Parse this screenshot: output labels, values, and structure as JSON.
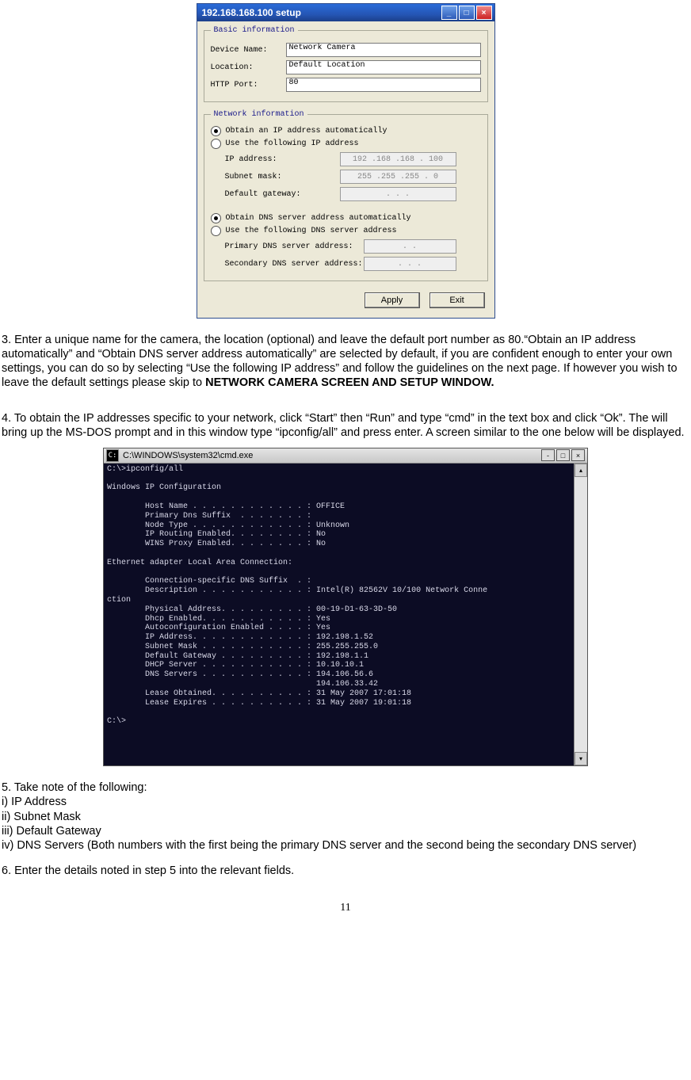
{
  "setup": {
    "title": "192.168.168.100 setup",
    "basic_legend": "Basic information",
    "device_name_label": "Device Name:",
    "device_name_value": "Network Camera",
    "location_label": "Location:",
    "location_value": "Default Location",
    "http_port_label": "HTTP Port:",
    "http_port_value": "80",
    "net_legend": "Network information",
    "radio_auto_ip": "Obtain an IP address automatically",
    "radio_static_ip": "Use the following IP address",
    "ip_label": "IP address:",
    "ip_value": "192 .168 .168 . 100",
    "mask_label": "Subnet mask:",
    "mask_value": "255 .255 .255 .  0",
    "gateway_label": "Default gateway:",
    "gateway_value": ".    .    .",
    "radio_auto_dns": "Obtain DNS server address automatically",
    "radio_static_dns": "Use the following DNS server address",
    "dns1_label": "Primary DNS server address:",
    "dns1_value": ".    .",
    "dns2_label": "Secondary DNS server address:",
    "dns2_value": ".    .    .",
    "apply": "Apply",
    "exit": "Exit"
  },
  "para3": "3. Enter a unique name for the camera, the location (optional) and leave the default port number as 80.“Obtain an IP address automatically” and “Obtain DNS server address automatically” are selected by default, if you are confident enough to enter your own settings, you can do so by selecting “Use the following IP address” and follow the guidelines on the next page. If however you wish to leave the default settings please skip to ",
  "para3_bold": "NETWORK CAMERA SCREEN AND SETUP WINDOW.",
  "para4": "4. To obtain the IP addresses specific to your network, click “Start” then “Run” and type “cmd” in the text box and click “Ok”. The will bring up the MS-DOS prompt and in this window type “ipconfig/all” and press enter. A screen similar to the one below will be displayed.",
  "cmd": {
    "title": "C:\\WINDOWS\\system32\\cmd.exe",
    "content": "C:\\>ipconfig/all\n\nWindows IP Configuration\n\n        Host Name . . . . . . . . . . . . : OFFICE\n        Primary Dns Suffix  . . . . . . . :\n        Node Type . . . . . . . . . . . . : Unknown\n        IP Routing Enabled. . . . . . . . : No\n        WINS Proxy Enabled. . . . . . . . : No\n\nEthernet adapter Local Area Connection:\n\n        Connection-specific DNS Suffix  . :\n        Description . . . . . . . . . . . : Intel(R) 82562V 10/100 Network Conne\nction\n        Physical Address. . . . . . . . . : 00-19-D1-63-3D-50\n        Dhcp Enabled. . . . . . . . . . . : Yes\n        Autoconfiguration Enabled . . . . : Yes\n        IP Address. . . . . . . . . . . . : 192.198.1.52\n        Subnet Mask . . . . . . . . . . . : 255.255.255.0\n        Default Gateway . . . . . . . . . : 192.198.1.1\n        DHCP Server . . . . . . . . . . . : 10.10.10.1\n        DNS Servers . . . . . . . . . . . : 194.106.56.6\n                                            194.106.33.42\n        Lease Obtained. . . . . . . . . . : 31 May 2007 17:01:18\n        Lease Expires . . . . . . . . . . : 31 May 2007 19:01:18\n\nC:\\>\n\n\n\n\n"
  },
  "para5_head": "5. Take note of the following:",
  "para5_i": "i) IP Address",
  "para5_ii": "ii) Subnet Mask",
  "para5_iii": "iii) Default Gateway",
  "para5_iv": "iv) DNS Servers (Both numbers with the first being the primary DNS server and the second being the secondary DNS server)",
  "para6": "6. Enter the details noted in step 5 into the relevant fields.",
  "pagenum": "11"
}
